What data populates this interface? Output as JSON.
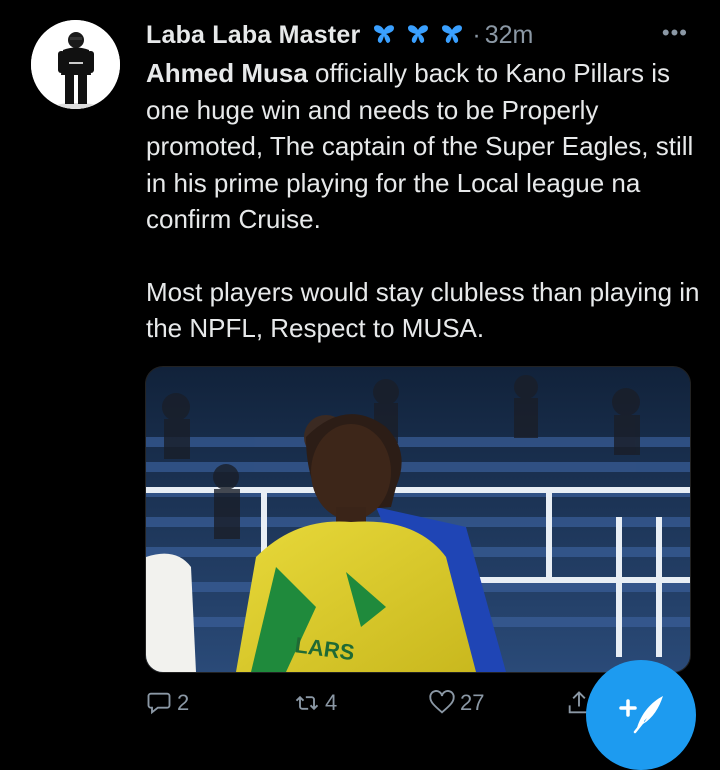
{
  "tweet": {
    "author_name": "Laba Laba Master",
    "separator": "·",
    "time": "32m",
    "more_label": "•••",
    "mention": "Ahmed Musa",
    "para1_rest": " officially back to Kano Pillars is one huge win and needs to be Properly promoted, The captain of the Super Eagles, still in his prime playing for the Local league na confirm Cruise.",
    "para2": "Most players would stay clubless than playing in the NPFL, Respect to MUSA.",
    "jersey_text": "LARS"
  },
  "actions": {
    "replies": "2",
    "retweets": "4",
    "likes": "27"
  },
  "icons": {
    "verified_decor": "butterfly-icon",
    "reply": "reply-icon",
    "retweet": "retweet-icon",
    "like": "heart-icon",
    "share": "share-icon",
    "compose": "compose-tweet-icon"
  },
  "colors": {
    "background": "#000000",
    "text": "#e7e9ea",
    "muted": "#8b98a5",
    "accent": "#1d9bf0",
    "butterfly": "#3aa0ff"
  }
}
